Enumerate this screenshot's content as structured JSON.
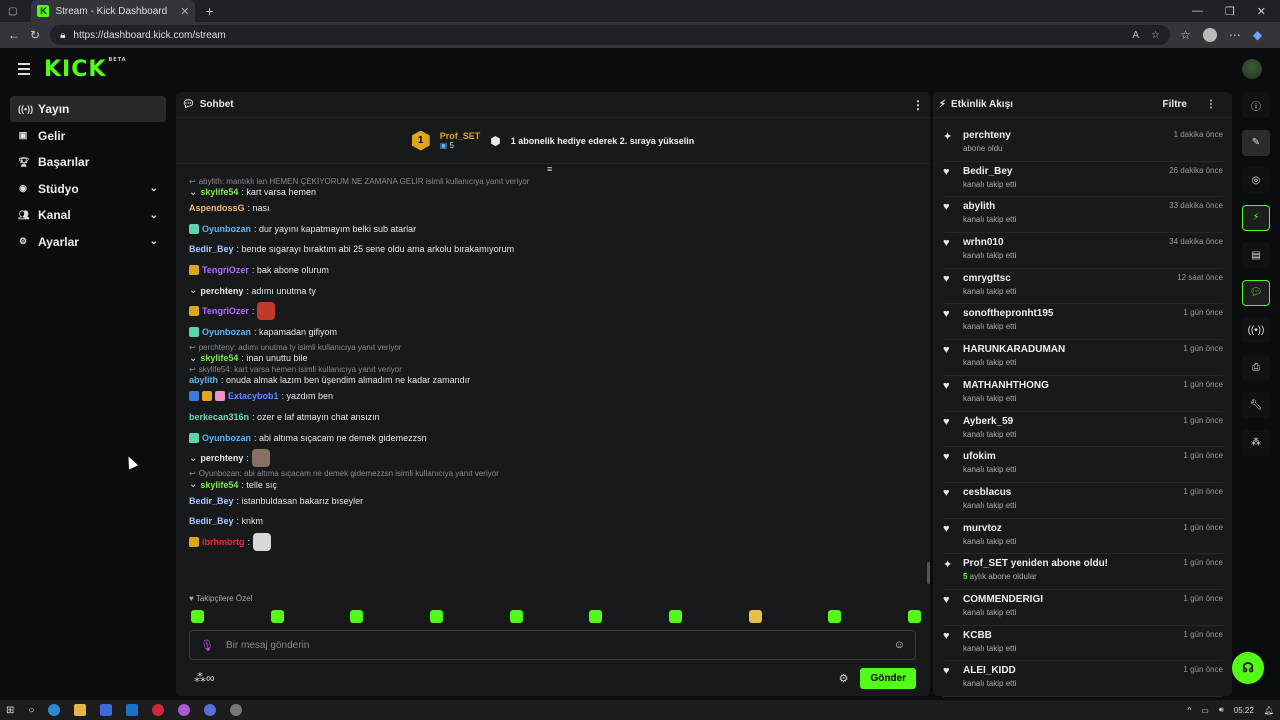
{
  "browser": {
    "tab_title": "Stream - Kick Dashboard",
    "url": "https://dashboard.kick.com/stream"
  },
  "app": {
    "logo": "KICK",
    "beta": "BETA"
  },
  "sidebar": {
    "items": [
      {
        "label": "Yayın",
        "icon": "broadcast-icon"
      },
      {
        "label": "Gelir",
        "icon": "revenue-icon"
      },
      {
        "label": "Başarılar",
        "icon": "trophy-icon"
      },
      {
        "label": "Stüdyo",
        "icon": "studio-icon"
      },
      {
        "label": "Kanal",
        "icon": "channel-icon"
      },
      {
        "label": "Ayarlar",
        "icon": "settings-icon"
      }
    ]
  },
  "chat": {
    "title": "Sohbet",
    "goal": {
      "rank": "1",
      "user": "Prof_SET",
      "count": "5",
      "text": "1 abonelik hediye ederek 2. sıraya yükselin"
    },
    "messages": [
      {
        "reply": "abylith: mantıklı lan HEMEN ÇEKİYORUM NE ZAMANA GELİR isimli kullanıcıya yanıt veriyor",
        "user": "skylife54",
        "color": "#7ce84a",
        "text": ": kart varsa hemen",
        "badge": "chevron"
      },
      {
        "user": "AspendossG",
        "color": "#f5b86b",
        "text": ": nası"
      },
      {
        "user": "Oyunbozan",
        "color": "#5bb5f5",
        "text": ": dur yayını kapatmayım belki sub atarlar",
        "badge": "gift"
      },
      {
        "user": "Bedir_Bey",
        "color": "#a8c8ff",
        "text": ": bende sıgarayı bıraktım abi 25 sene oldu ama arkolu bırakamıyorum"
      },
      {
        "user": "TengriOzer",
        "color": "#b36bff",
        "text": ": bak abone olurum",
        "badge": "crown"
      },
      {
        "user": "perchteny",
        "color": "#e8e8e8",
        "text": ": adımı unutma ty",
        "badge": "chevron"
      },
      {
        "user": "TengriOzer",
        "color": "#b36bff",
        "text": ":",
        "badge": "crown",
        "emote": "#c0392b"
      },
      {
        "user": "Oyunbozan",
        "color": "#5bb5f5",
        "text": ": kapamadan gifiyom",
        "badge": "gift"
      },
      {
        "reply": "perchteny: adımı unutma ty isimli kullanıcıya yanıt veriyor",
        "user": "skylife54",
        "color": "#7ce84a",
        "text": ": inan unuttu bile",
        "badge": "chevron"
      },
      {
        "reply": "skylife54: kart varsa hemen isimli kullanıcıya yanıt veriyor",
        "user": "abylith",
        "color": "#5bb5f5",
        "text": ": onuda almak lazım ben üşendim almadım ne kadar zamandır"
      },
      {
        "user": "Extacybob1",
        "color": "#5b8cff",
        "text": ": yazdım ben",
        "badge": "multi"
      },
      {
        "user": "berkecan316n",
        "color": "#5fe0b0",
        "text": ": ozer e laf atmayın chat ansızın"
      },
      {
        "user": "Oyunbozan",
        "color": "#5bb5f5",
        "text": ": abi altıma sıçacam ne demek gidemezzsn",
        "badge": "gift"
      },
      {
        "user": "perchteny",
        "color": "#e8e8e8",
        "text": ":",
        "badge": "chevron",
        "emote": "#8a6f66"
      },
      {
        "reply": "Oyunbozan: abi altıma sıçacam ne demek gidemezzsn isimli kullanıcıya yanıt veriyor",
        "user": "skylife54",
        "color": "#7ce84a",
        "text": ": telle sıç",
        "badge": "chevron"
      },
      {
        "user": "Bedir_Bey",
        "color": "#a8c8ff",
        "text": ": istanbuldasan bakarız bıseyler"
      },
      {
        "user": "Bedir_Bey",
        "color": "#a8c8ff",
        "text": ": knkm"
      },
      {
        "user": "ibrhmbrtg",
        "color": "#e0313a",
        "text": ":",
        "badge": "crown",
        "emote": "#d8d8d8"
      }
    ],
    "followers_only": "Takipçilere Özel",
    "input_placeholder": "Bir mesaj gönderin",
    "send_label": "Gönder"
  },
  "activity": {
    "title": "Etkinlik Akışı",
    "filter_label": "Filtre",
    "events": [
      {
        "icon": "sparkle-icon",
        "name": "perchteny",
        "sub": "abone oldu",
        "time": "1 dakika önce"
      },
      {
        "icon": "heart-icon",
        "name": "Bedir_Bey",
        "sub": "kanalı takip etti",
        "time": "26 dakika önce"
      },
      {
        "icon": "heart-icon",
        "name": "abylith",
        "sub": "kanalı takip etti",
        "time": "33 dakika önce"
      },
      {
        "icon": "heart-icon",
        "name": "wrhn010",
        "sub": "kanalı takip etti",
        "time": "34 dakika önce"
      },
      {
        "icon": "heart-icon",
        "name": "cmrygttsc",
        "sub": "kanalı takip etti",
        "time": "12 saat önce"
      },
      {
        "icon": "heart-icon",
        "name": "sonoftheprопht195",
        "sub": "kanalı takip etti",
        "time": "1 gün önce"
      },
      {
        "icon": "heart-icon",
        "name": "HARUNKARADUMAN",
        "sub": "kanalı takip etti",
        "time": "1 gün önce"
      },
      {
        "icon": "heart-icon",
        "name": "MATHANHTHONG",
        "sub": "kanalı takip etti",
        "time": "1 gün önce"
      },
      {
        "icon": "heart-icon",
        "name": "Ayberk_59",
        "sub": "kanalı takip etti",
        "time": "1 gün önce"
      },
      {
        "icon": "heart-icon",
        "name": "ufokim",
        "sub": "kanalı takip etti",
        "time": "1 gün önce"
      },
      {
        "icon": "heart-icon",
        "name": "cesblacus",
        "sub": "kanalı takip etti",
        "time": "1 gün önce"
      },
      {
        "icon": "heart-icon",
        "name": "murvtoz",
        "sub": "kanalı takip etti",
        "time": "1 gün önce"
      },
      {
        "icon": "sparkle-icon",
        "name": "Prof_SET yeniden abone oldu!",
        "sub_num": "5",
        "sub": " aylık abone oldular",
        "time": "1 gün önce"
      },
      {
        "icon": "heart-icon",
        "name": "COMMENDERIGI",
        "sub": "kanalı takip etti",
        "time": "1 gün önce"
      },
      {
        "icon": "heart-icon",
        "name": "KCBB",
        "sub": "kanalı takip etti",
        "time": "1 gün önce"
      },
      {
        "icon": "heart-icon",
        "name": "ALEI_KIDD",
        "sub": "kanalı takip etti",
        "time": "1 gün önce"
      }
    ]
  },
  "taskbar": {
    "time": "05:22"
  }
}
